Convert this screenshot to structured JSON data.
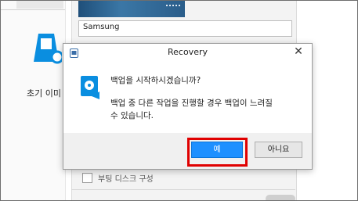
{
  "background": {
    "sidebar_item_label": "초기 이미",
    "device_name_value": "Samsung",
    "boot_disk_label": "부팅 디스크 구성"
  },
  "dialog": {
    "title": "Recovery",
    "close_glyph": "✕",
    "message_main": "백업을 시작하시겠습니까?",
    "message_detail": "백업 중 다른 작업을 진행할 경우 백업이 느려질 수 있습니다.",
    "ok_label": "예",
    "cancel_label": "아니요"
  },
  "icons": {
    "app": "app-recovery-icon",
    "message": "backup-disk-icon",
    "sidebar": "restore-device-icon"
  },
  "colors": {
    "accent": "#1e90ff",
    "highlight": "#e00000",
    "icon_blue": "#0a8ee0"
  }
}
